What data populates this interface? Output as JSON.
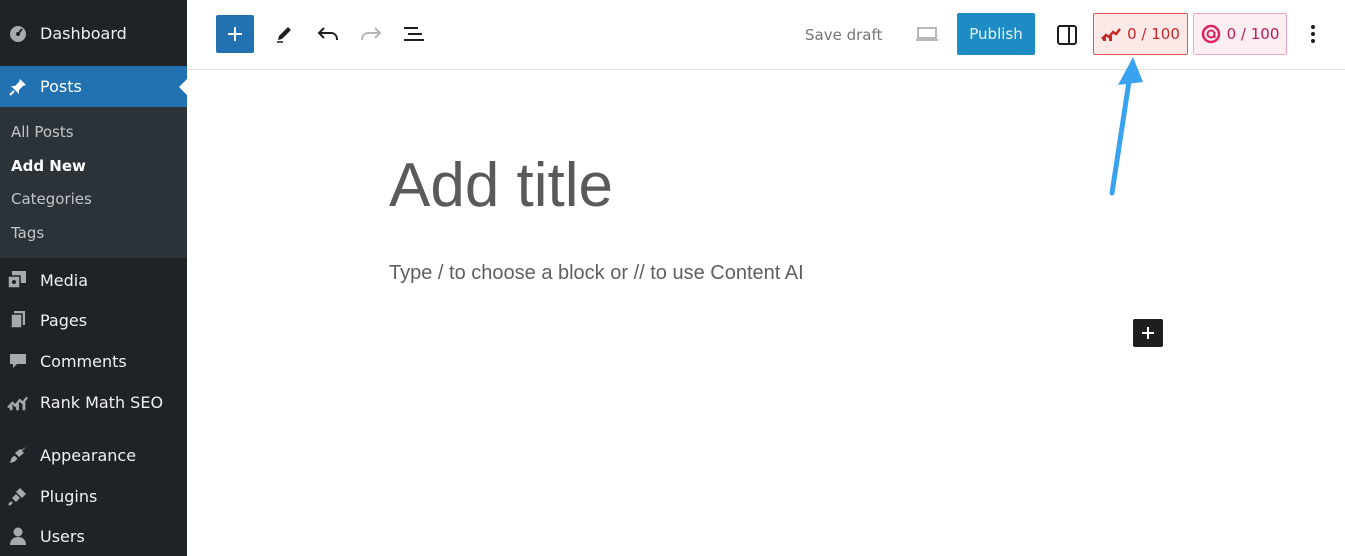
{
  "sidebar": {
    "menu": [
      {
        "label": "Dashboard",
        "icon": "dashboard-icon"
      },
      {
        "label": "Posts",
        "icon": "pin-icon"
      },
      {
        "label": "Media",
        "icon": "media-icon"
      },
      {
        "label": "Pages",
        "icon": "pages-icon"
      },
      {
        "label": "Comments",
        "icon": "comment-icon"
      },
      {
        "label": "Rank Math SEO",
        "icon": "rank-math-icon"
      },
      {
        "label": "Appearance",
        "icon": "paintbrush-icon"
      },
      {
        "label": "Plugins",
        "icon": "plugin-icon"
      },
      {
        "label": "Users",
        "icon": "user-icon"
      }
    ],
    "posts_submenu": [
      {
        "label": "All Posts"
      },
      {
        "label": "Add New"
      },
      {
        "label": "Categories"
      },
      {
        "label": "Tags"
      }
    ],
    "active_item": "Posts",
    "current_subitem": "Add New"
  },
  "toolbar": {
    "save_draft_label": "Save draft",
    "publish_label": "Publish",
    "seo_score": "0 / 100",
    "content_ai_score": "0 / 100"
  },
  "editor": {
    "title_placeholder": "Add title",
    "block_placeholder": "Type / to choose a block or // to use Content AI"
  },
  "colors": {
    "sidebar_bg": "#1d2327",
    "active_blue": "#2271b1",
    "publish_blue": "#1e8cc4",
    "seo_red": "#c62828",
    "ai_pink": "#c2185b",
    "arrow_blue": "#3aa3f0"
  }
}
